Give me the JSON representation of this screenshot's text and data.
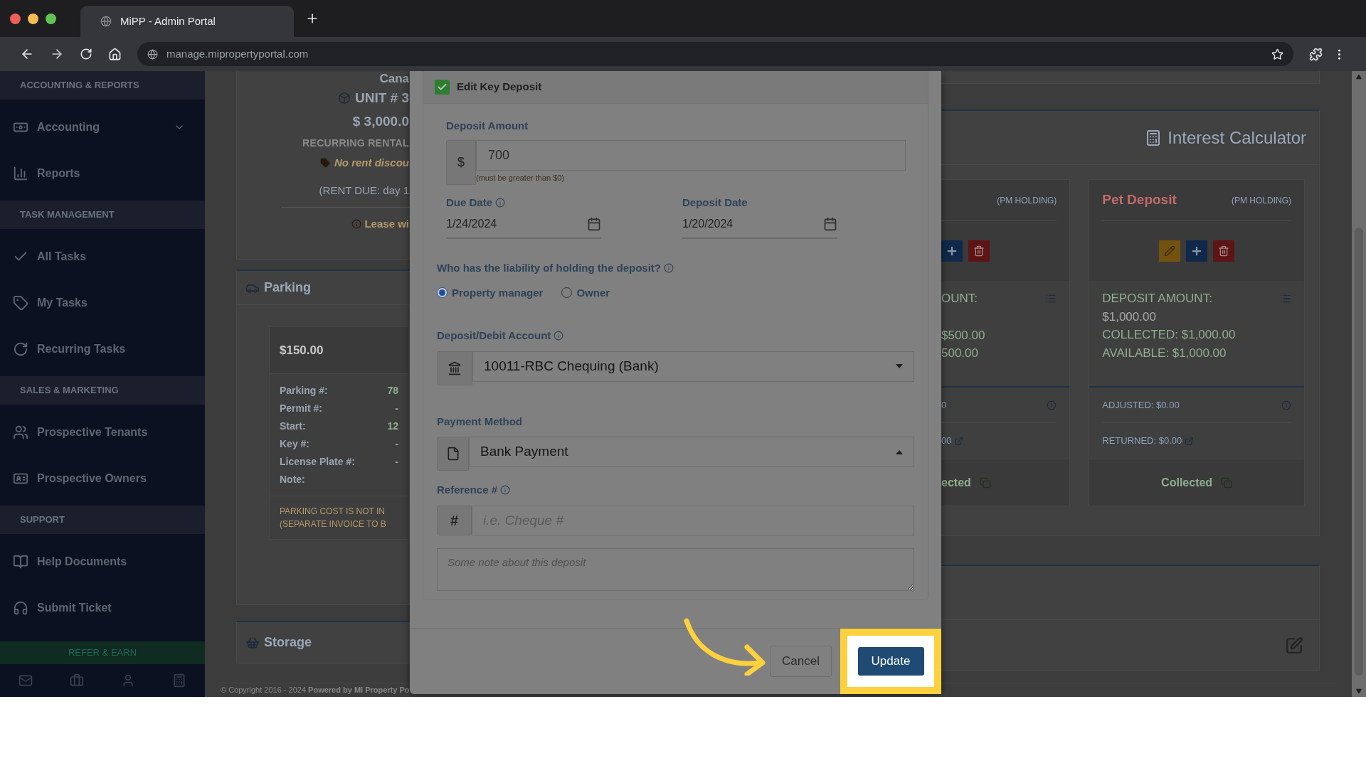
{
  "browser": {
    "tab_title": "MiPP - Admin Portal",
    "url": "manage.mipropertyportal.com"
  },
  "sidebar": {
    "sections": [
      {
        "title": "ACCOUNTING & REPORTS",
        "items": [
          {
            "label": "Accounting",
            "expanded": false
          },
          {
            "label": "Reports"
          }
        ]
      },
      {
        "title": "TASK MANAGEMENT",
        "items": [
          {
            "label": "All Tasks"
          },
          {
            "label": "My Tasks"
          },
          {
            "label": "Recurring Tasks"
          }
        ]
      },
      {
        "title": "SALES & MARKETING",
        "items": [
          {
            "label": "Prospective Tenants"
          },
          {
            "label": "Prospective Owners"
          }
        ]
      },
      {
        "title": "SUPPORT",
        "items": [
          {
            "label": "Help Documents"
          },
          {
            "label": "Submit Ticket"
          }
        ]
      }
    ],
    "refer_button": "REFER & EARN"
  },
  "unit_card": {
    "lines": [
      "Cana",
      "UNIT # 3",
      "$ 3,000.0",
      "RECURRING RENTAL",
      "No rent discou",
      "(RENT DUE: day 1",
      "Lease wi"
    ]
  },
  "parking": {
    "title": "Parking",
    "price": "$150.00",
    "rows": [
      {
        "label": "Parking #:",
        "value": "78"
      },
      {
        "label": "Permit #:",
        "value": "-"
      },
      {
        "label": "Start:",
        "value": "12"
      },
      {
        "label": "Key #:",
        "value": "-"
      },
      {
        "label": "License Plate #:",
        "value": "-"
      },
      {
        "label": "Note:"
      }
    ],
    "notice": [
      "PARKING COST IS NOT IN",
      "(SEPARATE INVOICE TO B"
    ]
  },
  "storage": {
    "title": "Storage"
  },
  "footer": "© Copyright 2016 - 2024 **Powered by MI Property Po**",
  "interest_calculator": {
    "title": "Interest Calculator",
    "deposits": [
      {
        "tag": "(PM HOLDING)",
        "amount_label": "OUNT:",
        "collected": "$500.00",
        "available": "500.00",
        "adjusted": "0",
        "returned": "00",
        "status": "ected"
      },
      {
        "title": "Pet Deposit",
        "tag": "(PM HOLDING)",
        "amount_label": "DEPOSIT AMOUNT:",
        "amount": "$1,000.00",
        "collected": "COLLECTED: $1,000.00",
        "available": "AVAILABLE: $1,000.00",
        "adjusted": "ADJUSTED: $0.00",
        "returned": "RETURNED: $0.00",
        "status": "Collected"
      }
    ]
  },
  "modal": {
    "edit_checkbox": {
      "label": "Edit Key Deposit",
      "checked": true
    },
    "deposit_amount": {
      "label": "Deposit Amount",
      "prefix": "$",
      "value": "700",
      "hint": "(must be greater than $0)"
    },
    "dates": [
      {
        "label": "Due Date",
        "value": "1/24/2024",
        "info": true
      },
      {
        "label": "Deposit Date",
        "value": "1/20/2024",
        "info": false
      }
    ],
    "liability": {
      "question": "Who has the liability of holding the deposit?",
      "options": [
        {
          "label": "Property manager",
          "selected": true
        },
        {
          "label": "Owner",
          "selected": false
        }
      ]
    },
    "account": {
      "label": "Deposit/Debit Account",
      "value": "10011-RBC Chequing (Bank)",
      "expanded": false
    },
    "payment_method": {
      "label": "Payment Method",
      "value": "Bank Payment",
      "expanded": true
    },
    "reference": {
      "label": "Reference #",
      "prefix": "#",
      "placeholder": "i.e. Cheque #"
    },
    "note": {
      "placeholder": "Some note about this deposit"
    },
    "buttons": {
      "cancel": "Cancel",
      "update": "Update"
    }
  }
}
